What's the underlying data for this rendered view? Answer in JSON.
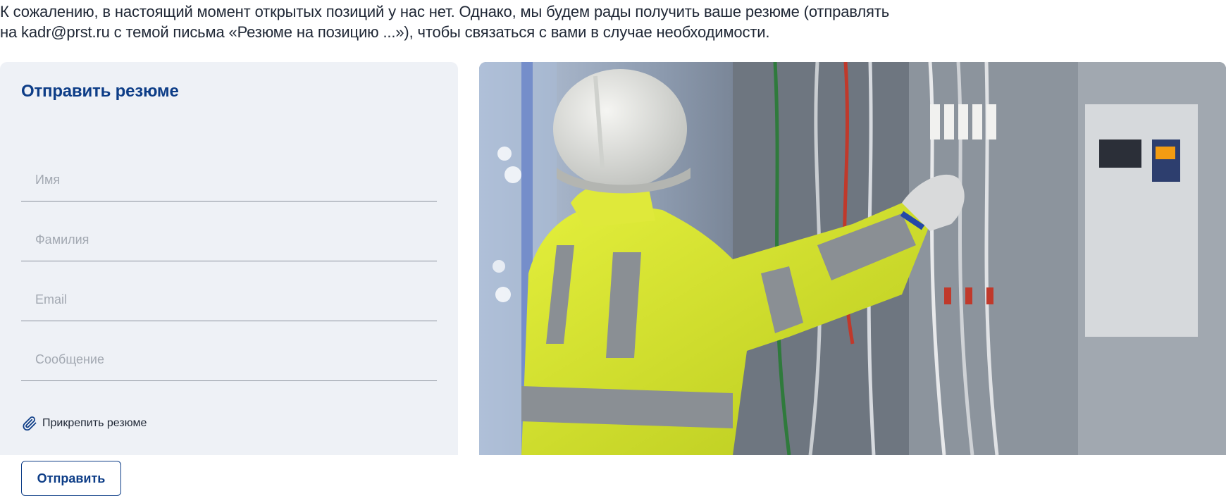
{
  "intro": {
    "line1": "К сожалению, в настоящий момент открытых позиций у нас нет. Однако, мы будем рады получить ваше резюме (отправлять",
    "line2": "на kadr@prst.ru с темой письма «Резюме на позицию ...»), чтобы связаться с вами в случае необходимости."
  },
  "form": {
    "title": "Отправить резюме",
    "fields": {
      "first_name": {
        "placeholder": "Имя",
        "value": ""
      },
      "last_name": {
        "placeholder": "Фамилия",
        "value": ""
      },
      "email": {
        "placeholder": "Email",
        "value": ""
      },
      "message": {
        "placeholder": "Сообщение",
        "value": ""
      }
    },
    "attach_label": "Прикрепить резюме",
    "submit_label": "Отправить"
  },
  "icons": {
    "attach": "paperclip-icon"
  },
  "colors": {
    "accent": "#0d3d87",
    "panel_bg": "#eef1f6",
    "text": "#1f2735",
    "placeholder": "#a3a9b2"
  }
}
